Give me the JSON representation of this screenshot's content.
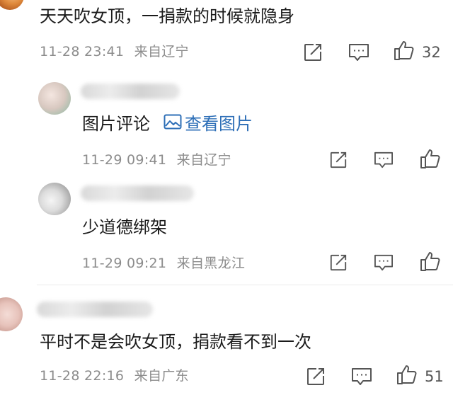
{
  "comments": [
    {
      "text": "天天吹女顶，一捐款的时候就隐身",
      "time": "11-28 23:41",
      "location": "来自辽宁",
      "likes": "32",
      "replies": [
        {
          "image_label": "图片评论",
          "view_image": "查看图片",
          "time": "11-29 09:41",
          "location": "来自辽宁"
        },
        {
          "text": "少道德绑架",
          "time": "11-29 09:21",
          "location": "来自黑龙江"
        }
      ]
    },
    {
      "text": "平时不是会吹女顶，捐款看不到一次",
      "time": "11-28 22:16",
      "location": "来自广东",
      "likes": "51"
    }
  ],
  "icons": {
    "share": "share-icon",
    "comment": "comment-icon",
    "like": "thumbs-up-icon",
    "image": "image-icon"
  },
  "colors": {
    "link": "#2e6fb7",
    "meta": "#8c8c8c",
    "text": "#1b1b1b"
  }
}
